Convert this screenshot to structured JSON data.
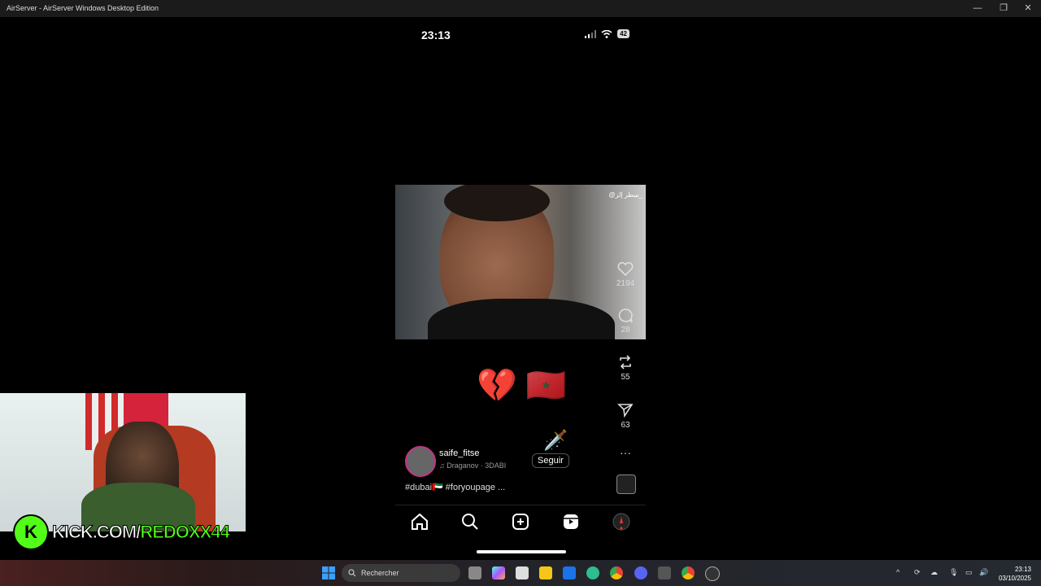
{
  "window": {
    "title": "AirServer - AirServer Windows Desktop Edition"
  },
  "status": {
    "time": "23:13",
    "battery": "42"
  },
  "post": {
    "watermark": "@سطر إلز_",
    "likes": "2194",
    "comments": "28",
    "reposts": "55",
    "shares": "63",
    "username": "saife_fitse",
    "song": "Draganov · 3DABI",
    "follow": "Seguir",
    "caption": "#dubai🇦🇪 #foryoupage ..."
  },
  "webcam": {
    "banner_prefix": "KICK.COM/",
    "banner_name": "REDOXX44"
  },
  "taskbar": {
    "search_placeholder": "Rechercher",
    "time": "23:13",
    "date": "03/10/2025"
  }
}
